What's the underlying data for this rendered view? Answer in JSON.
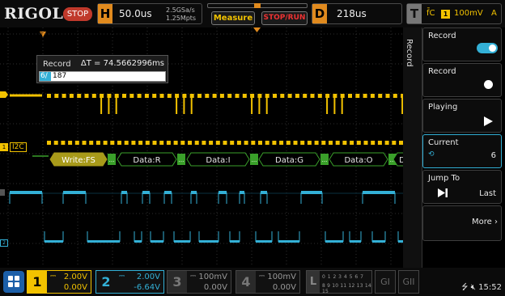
{
  "topbar": {
    "logo": "RIGOL",
    "run_state": "STOP",
    "horizontal": {
      "tag": "H",
      "timebase": "50.0us",
      "sample_rate": "2.5GSa/s",
      "memory_depth": "1.25Mpts"
    },
    "measure_label": "Measure",
    "stoprun_label": "STOP/RUN",
    "delay": {
      "tag": "D",
      "value": "218us"
    },
    "trigger": {
      "tag": "T",
      "icon_text": "f̄C",
      "channel": "1",
      "level": "100mV",
      "mode": "A"
    }
  },
  "record_popup": {
    "title": "Record",
    "delta_t": "ΔT = 74.5662996ms",
    "field_channel": "6/",
    "field_value": "187"
  },
  "waveform": {
    "i2c_label": "I2C",
    "i2c_channel": "1",
    "ch2_marker": "2",
    "decode_frames": [
      "Write:FS",
      "Data:R",
      "Data:I",
      "Data:G",
      "Data:O",
      "D"
    ],
    "ack_marker": "..."
  },
  "sidepanel": {
    "tab_label": "Record",
    "items": [
      {
        "label": "Record",
        "control": "toggle-on"
      },
      {
        "label": "Record",
        "control": "record-dot"
      },
      {
        "label": "Playing",
        "control": "play"
      },
      {
        "label": "Current",
        "value": "6"
      },
      {
        "label": "Jump To",
        "value": "Last"
      },
      {
        "label": "More"
      }
    ]
  },
  "bottombar": {
    "channels": [
      {
        "num": "1",
        "coupling": "⎓",
        "scale": "2.00V",
        "offset": "0.00V",
        "color": "#f2c200",
        "active": true
      },
      {
        "num": "2",
        "coupling": "⎓",
        "scale": "2.00V",
        "offset": "-6.64V",
        "color": "#33b0d6",
        "active": true
      },
      {
        "num": "3",
        "coupling": "⎓",
        "scale": "100mV",
        "offset": "0.00V",
        "color": "#888888",
        "active": false
      },
      {
        "num": "4",
        "coupling": "⎓",
        "scale": "100mV",
        "offset": "0.00V",
        "color": "#888888",
        "active": false
      }
    ],
    "logic": {
      "label": "L",
      "row1": "0 1 2 3  4 5 6 7",
      "row2": "8 9 10 11 12 13 14 15"
    },
    "gen1": "GI",
    "gen2": "GII",
    "time": "15:52"
  },
  "colors": {
    "ch1": "#f2c200",
    "ch2": "#33b0d6",
    "accent": "#e08a1e",
    "decode_bg": "#a89a1a"
  }
}
